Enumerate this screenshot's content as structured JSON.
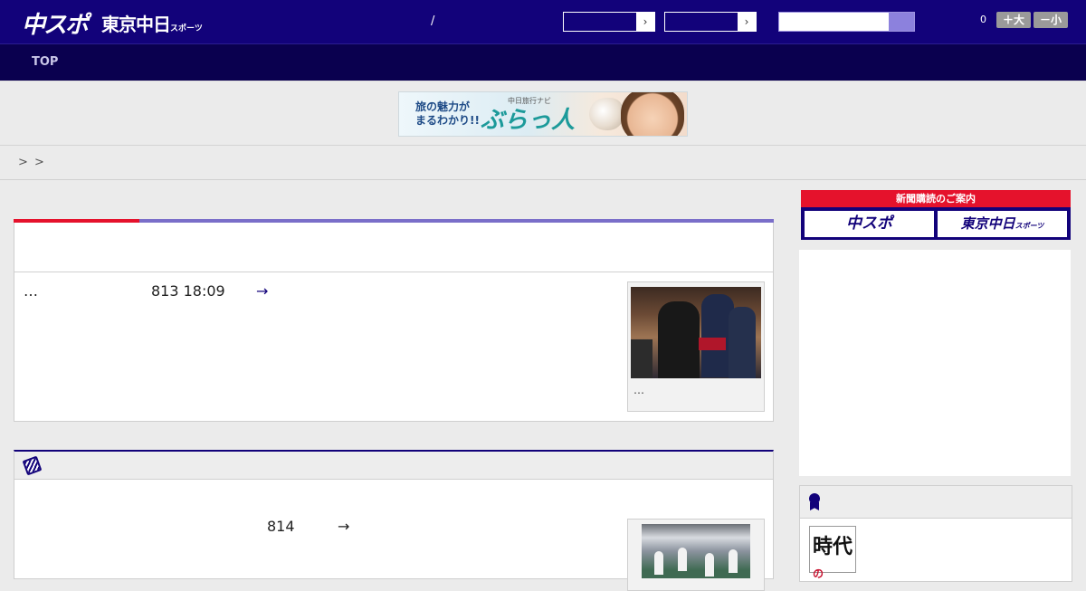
{
  "header": {
    "logo_main": "中スポ",
    "logo_tokyo": "東京中日",
    "logo_tokyo_sub": "スポーツ",
    "separator": "/",
    "select_arrow": "›",
    "font_count": "0",
    "font_larger": "＋大",
    "font_smaller": "－小"
  },
  "nav": {
    "top_label": "TOP"
  },
  "banner": {
    "line1": "旅の魅力が",
    "line2": "まるわかり!!",
    "sub": "中日旅行ナビ",
    "brand": "ぶらっ人"
  },
  "breadcrumb": {
    "sep1": ">",
    "sep2": ">"
  },
  "article1": {
    "snippet": "…",
    "date": "813 18:09",
    "arrow": "→",
    "caption": "…"
  },
  "article2": {
    "date": "814",
    "arrow": "→"
  },
  "sidebar": {
    "subscribe_head": "新聞購読のご案内",
    "subscribe_chuspo": "中スポ",
    "subscribe_tokyo": "東京中日",
    "subscribe_tokyo_sub": "スポーツ",
    "ranking_thumb_text": "時代",
    "ranking_thumb_mark": "の"
  },
  "colors": {
    "brand_navy": "#12027a",
    "nav_dark": "#0a004f",
    "accent_red": "#e5122c",
    "accent_violet": "#7a6ec9"
  }
}
